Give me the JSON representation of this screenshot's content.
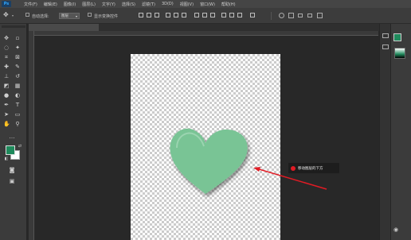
{
  "app": {
    "logo": "Ps"
  },
  "menubar": {
    "items": [
      "文件(F)",
      "编辑(E)",
      "图像(I)",
      "图层(L)",
      "文字(Y)",
      "选择(S)",
      "滤镜(T)",
      "3D(D)",
      "视图(V)",
      "窗口(W)",
      "帮助(H)"
    ]
  },
  "options": {
    "auto_select_label": "自动选择:",
    "auto_select_target": "图层",
    "show_transform_label": "显示变换控件"
  },
  "document": {
    "tab_title": ""
  },
  "annotation": {
    "text": "移动图层的下方"
  },
  "colors": {
    "heart_fill": "#79c495",
    "foreground_swatch": "#1f8a5c",
    "background_swatch": "#ffffff",
    "annotation_arrow": "#e01b24"
  },
  "icons": {
    "tools": [
      "move-icon",
      "marquee-icon",
      "lasso-icon",
      "magic-wand-icon",
      "crop-icon",
      "eyedropper-icon",
      "healing-icon",
      "brush-icon",
      "clone-stamp-icon",
      "history-brush-icon",
      "eraser-icon",
      "gradient-icon",
      "blur-icon",
      "dodge-icon",
      "pen-icon",
      "type-icon",
      "path-select-icon",
      "shape-icon",
      "hand-icon",
      "zoom-icon"
    ]
  }
}
